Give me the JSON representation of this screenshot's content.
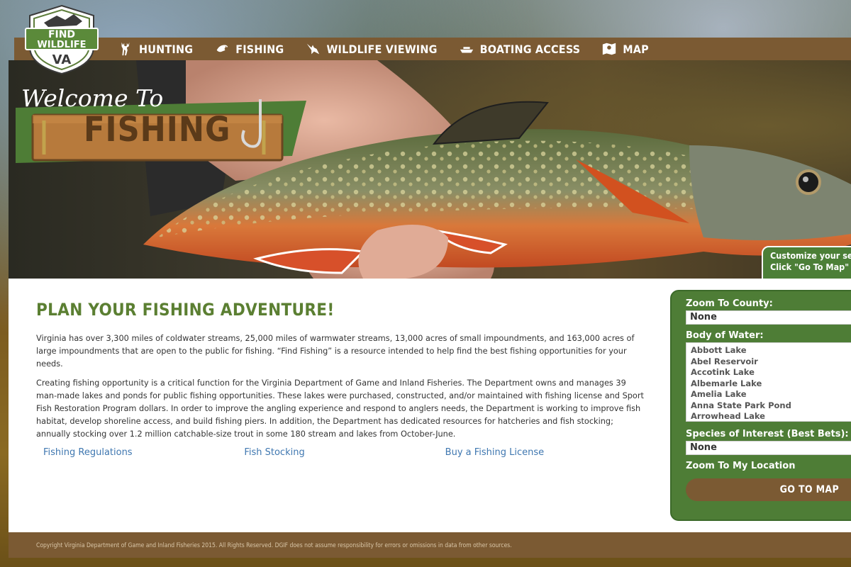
{
  "logo": {
    "line1": "FIND",
    "line2": "WILDLIFE",
    "line3": "VA"
  },
  "nav": [
    {
      "label": "HUNTING",
      "icon": "deer-icon"
    },
    {
      "label": "FISHING",
      "icon": "fish-icon"
    },
    {
      "label": "WILDLIFE VIEWING",
      "icon": "bird-icon"
    },
    {
      "label": "BOATING ACCESS",
      "icon": "boat-icon"
    },
    {
      "label": "MAP",
      "icon": "map-icon"
    }
  ],
  "hero": {
    "welcome": "Welcome To",
    "sign": "FISHING",
    "tip_line1": "Customize your searc",
    "tip_line2": "Click \"Go To Map\" to c"
  },
  "main": {
    "title": "PLAN YOUR FISHING ADVENTURE!",
    "para1": "Virginia has over 3,300 miles of coldwater streams, 25,000 miles of warmwater streams, 13,000 acres of small impoundments, and 163,000 acres of large impoundments that are open to the public for fishing. “Find Fishing” is a resource intended to help find the best fishing opportunities for your needs.",
    "para2": "Creating fishing opportunity is a critical function for the Virginia Department of Game and Inland Fisheries. The Department owns and manages 39 man-made lakes and ponds for public fishing opportunities. These lakes were purchased, constructed, and/or maintained with fishing license and Sport Fish Restoration Program dollars. In order to improve the angling experience and respond to anglers needs, the Department is working to improve fish habitat, develop shoreline access, and build fishing piers. In addition, the Department has dedicated resources for hatcheries and fish stocking; annually stocking over 1.2 million catchable-size trout in some 180 stream and lakes from October-June.",
    "links": [
      "Fishing Regulations",
      "Fish Stocking",
      "Buy a Fishing License"
    ]
  },
  "search": {
    "county_label": "Zoom To County:",
    "county_value": "None",
    "water_label": "Body of Water:",
    "water_options": [
      "Abbott Lake",
      "Abel Reservoir",
      "Accotink Lake",
      "Albemarle Lake",
      "Amelia Lake",
      "Anna State Park Pond",
      "Arrowhead Lake"
    ],
    "species_label": "Species of Interest (Best Bets):",
    "species_value": "None",
    "zoom_location": "Zoom To My Location",
    "go_button": "GO TO MAP"
  },
  "footer": {
    "copyright": "Copyright Virginia Department of Game and Inland Fisheries 2015. All Rights Reserved. DGIF does not assume responsibility for errors or omissions in data from other sources."
  },
  "colors": {
    "brown": "#7b5a33",
    "green": "#4e7d36",
    "title_green": "#5b7f32",
    "link_blue": "#3f77b0"
  }
}
